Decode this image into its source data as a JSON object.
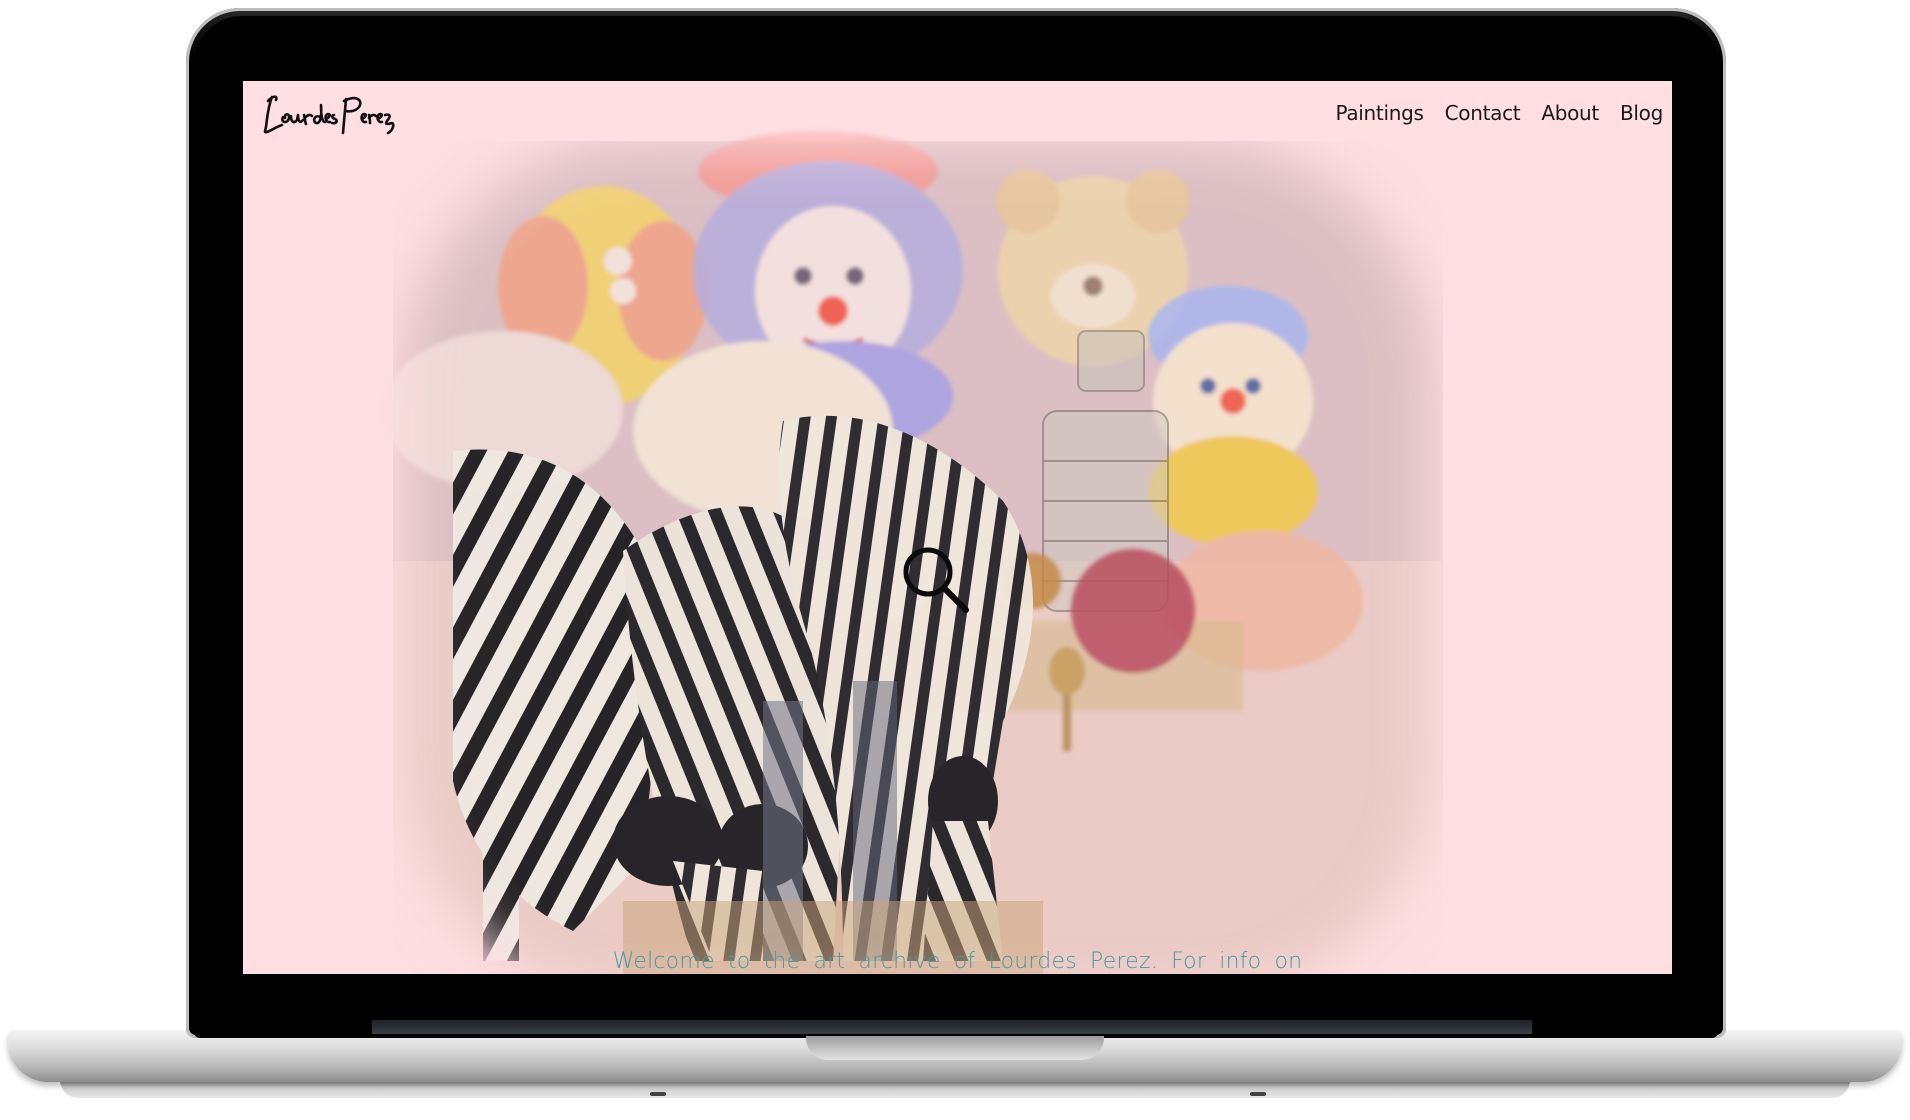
{
  "site": {
    "logo_text": "Lourdes Perez",
    "background_color": "#ffdfe2",
    "accent_color": "#4a9a9e"
  },
  "nav": {
    "items": [
      {
        "label": "Paintings"
      },
      {
        "label": "Contact"
      },
      {
        "label": "About"
      },
      {
        "label": "Blog"
      }
    ]
  },
  "hero": {
    "search_icon": "magnifier-icon",
    "welcome_text": "Welcome to the art archive of Lourdes Perez. For info on"
  }
}
